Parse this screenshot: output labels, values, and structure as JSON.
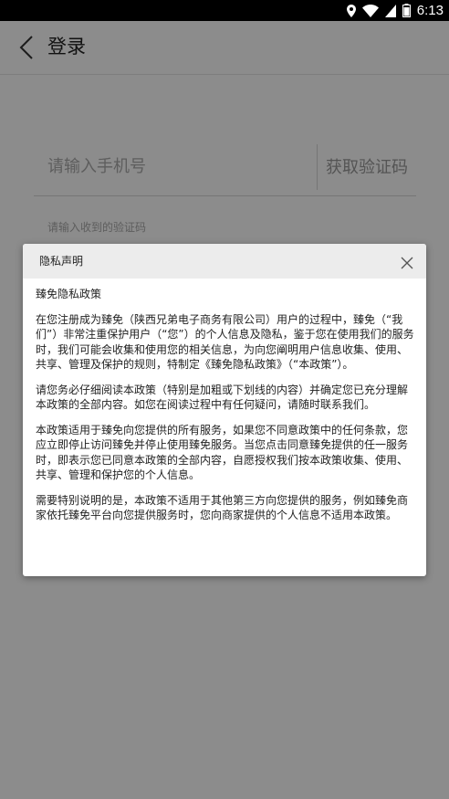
{
  "status_bar": {
    "time": "6:13",
    "icons": [
      "location-icon",
      "wifi-icon",
      "signal-icon",
      "battery-icon"
    ]
  },
  "app_bar": {
    "title": "登录"
  },
  "login_form": {
    "phone_placeholder": "请输入手机号",
    "get_code_label": "获取验证码",
    "code_placeholder": "请输入收到的验证码"
  },
  "dialog": {
    "title": "隐私声明",
    "heading": "臻免隐私政策",
    "paragraphs": [
      "在您注册成为臻免（陕西兄弟电子商务有限公司）用户的过程中，臻免（“我们”）非常注重保护用户（“您”）的个人信息及隐私，鉴于您在使用我们的服务时，我们可能会收集和使用您的相关信息，为向您阐明用户信息收集、使用、共享、管理及保护的规则，特制定《臻免隐私政策》（“本政策”）。",
      "请您务必仔细阅读本政策（特别是加粗或下划线的内容）并确定您已充分理解本政策的全部内容。如您在阅读过程中有任何疑问，请随时联系我们。",
      "本政策适用于臻免向您提供的所有服务，如果您不同意政策中的任何条款，您应立即停止访问臻免并停止使用臻免服务。当您点击同意臻免提供的任一服务时，即表示您已同意本政策的全部内容，自愿授权我们按本政策收集、使用、共享、管理和保护您的个人信息。",
      "需要特别说明的是，本政策不适用于其他第三方向您提供的服务，例如臻免商家依托臻免平台向您提供服务时，您向商家提供的个人信息不适用本政策。"
    ]
  },
  "colors": {
    "status_bar_bg": "#000000",
    "overlay": "rgba(0,0,0,0.45)",
    "dialog_header_bg": "#ececec"
  }
}
